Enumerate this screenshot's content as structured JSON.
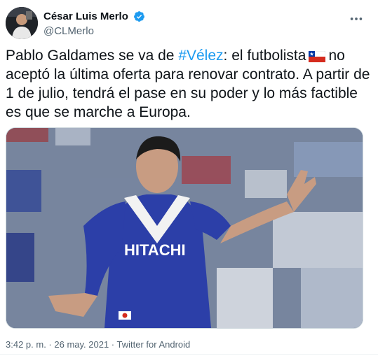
{
  "author": {
    "display_name": "César Luis Merlo",
    "handle": "@CLMerlo",
    "verified": true,
    "avatar_icon": "avatar-photo"
  },
  "tweet": {
    "text_part1": "Pablo Galdames se va de ",
    "hashtag": "#Vélez",
    "text_part2": ": el futbolista",
    "flag_icon": "chile-flag-emoji",
    "text_part3": "no aceptó la última oferta para renovar contrato. A partir de 1 de julio, tendrá el pase en su poder y lo más factible es que se marche a Europa.",
    "media": {
      "alt": "Player in blue Vélez jersey gesturing on the pitch",
      "jersey_text": "HITACHI"
    }
  },
  "meta": {
    "time": "3:42 p. m.",
    "separator": " · ",
    "date": "26 may. 2021",
    "separator2": " · ",
    "client": "Twitter for Android"
  },
  "colors": {
    "accent": "#1d9bf0",
    "text": "#0f1419",
    "secondary": "#536471",
    "jersey_blue": "#2c3fa8"
  }
}
